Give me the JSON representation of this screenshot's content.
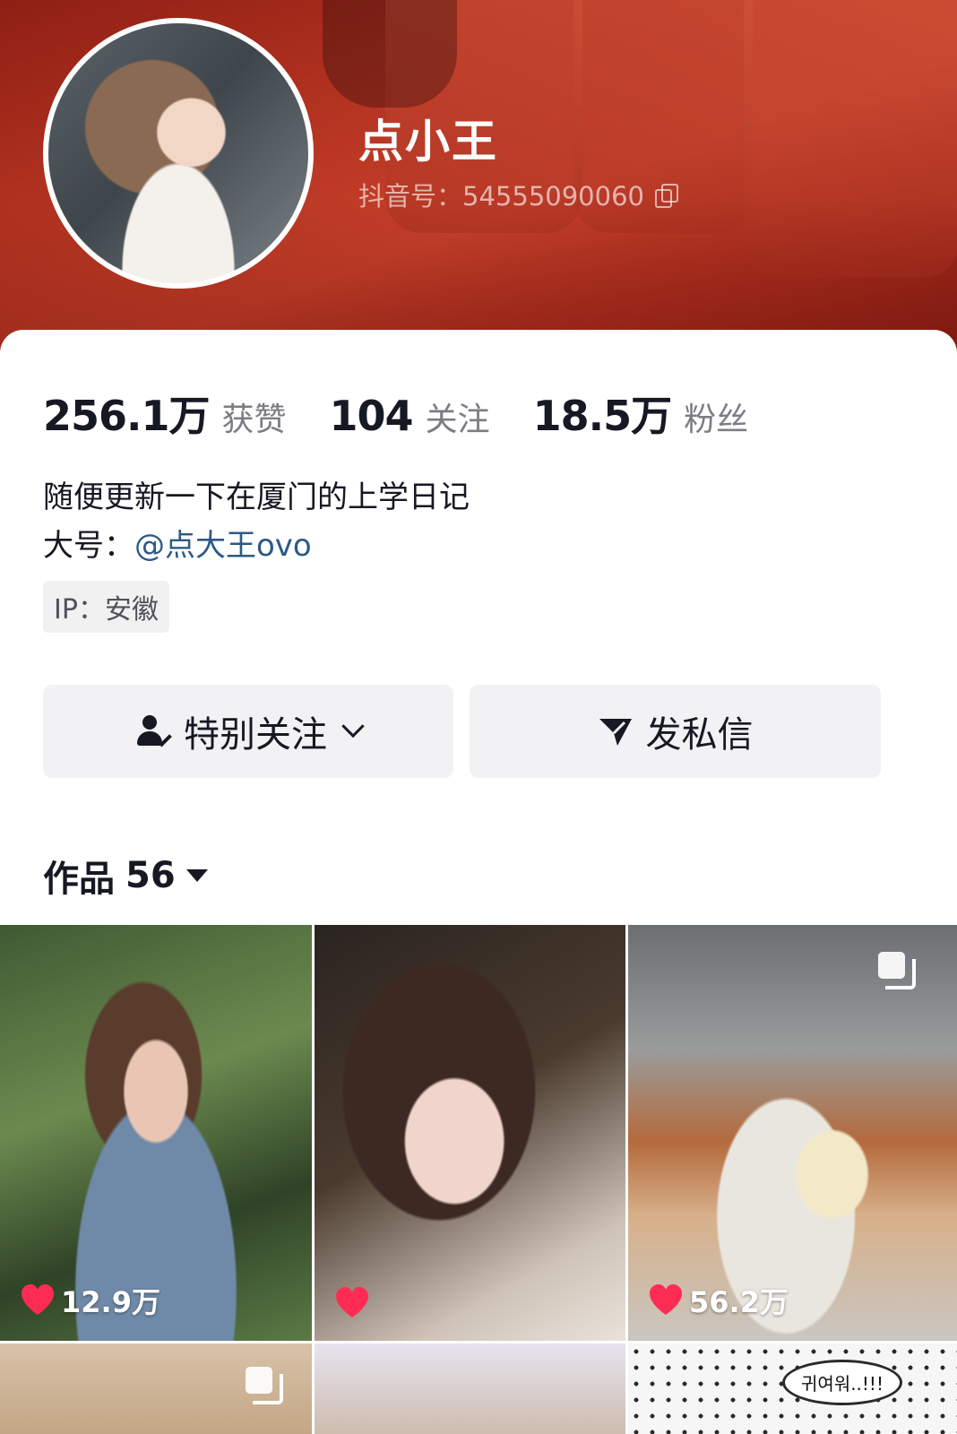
{
  "profile": {
    "username": "点小王",
    "douyin_id_label": "抖音号：",
    "douyin_id": "54555090060"
  },
  "stats": [
    {
      "value": "256.1万",
      "label": "获赞"
    },
    {
      "value": "104",
      "label": "关注"
    },
    {
      "value": "18.5万",
      "label": "粉丝"
    }
  ],
  "bio": {
    "line1": "随便更新一下在厦门的上学日记",
    "line2_prefix": "大号：",
    "line2_link": "@点大王ovo"
  },
  "ip": {
    "text": "IP：安徽"
  },
  "actions": {
    "follow_label": "特别关注",
    "message_label": "发私信"
  },
  "works": {
    "label": "作品",
    "count": "56",
    "items": [
      {
        "likes": "12.9万",
        "multi_image": false
      },
      {
        "likes": "",
        "multi_image": false
      },
      {
        "likes": "56.2万",
        "multi_image": true
      },
      {
        "likes": "",
        "multi_image": true
      },
      {
        "likes": "",
        "multi_image": false
      },
      {
        "likes": "",
        "multi_image": false,
        "caption": "귀여워..!!!"
      }
    ]
  },
  "colors": {
    "banner": "#b23220",
    "heart": "#fe2c55",
    "link": "#2c5a86",
    "button_bg": "#f2f2f4"
  },
  "icons": [
    "copy-icon",
    "person-check-icon",
    "chevron-down-icon",
    "send-icon",
    "caret-down-icon",
    "heart-icon",
    "multi-image-icon"
  ]
}
